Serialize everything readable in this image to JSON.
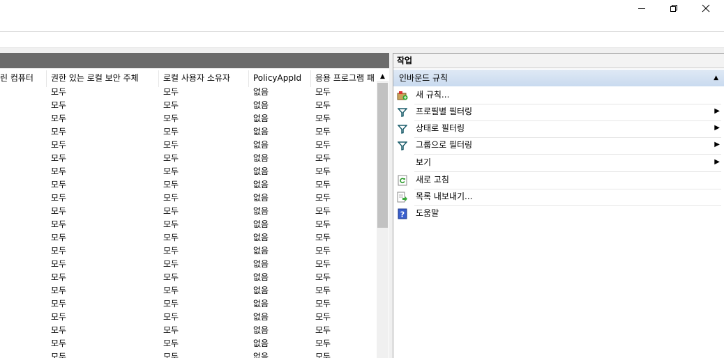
{
  "window": {
    "controls": [
      {
        "name": "minimize",
        "glyph": "—"
      },
      {
        "name": "restore",
        "glyph": "❐"
      },
      {
        "name": "close",
        "glyph": "✕"
      }
    ]
  },
  "table": {
    "columns": [
      "린 컴퓨터",
      "권한 있는 로컬 보안 주체",
      "로컬 사용자 소유자",
      "PolicyAppId",
      "응용 프로그램 패"
    ],
    "row_values": [
      "",
      "모두",
      "모두",
      "없음",
      "모두"
    ],
    "partial_row_values": [
      "",
      "모두",
      "모두",
      "없음",
      "모두"
    ],
    "row_count": 20,
    "scroll_up_glyph": "▲"
  },
  "actions": {
    "title": "작업",
    "section": {
      "title": "인바운드 규칙",
      "collapse_glyph": "▲"
    },
    "items": [
      {
        "id": "new-rule",
        "label": "새 규칙...",
        "icon": "new-rule-icon",
        "submenu": false
      },
      {
        "id": "filter-profile",
        "label": "프로필별 필터링",
        "icon": "filter-icon",
        "submenu": true
      },
      {
        "id": "filter-state",
        "label": "상태로 필터링",
        "icon": "filter-icon",
        "submenu": true
      },
      {
        "id": "filter-group",
        "label": "그룹으로 필터링",
        "icon": "filter-icon",
        "submenu": true
      },
      {
        "id": "view",
        "label": "보기",
        "icon": "",
        "submenu": true
      },
      {
        "id": "refresh",
        "label": "새로 고침",
        "icon": "refresh-icon",
        "submenu": false
      },
      {
        "id": "export-list",
        "label": "목록 내보내기...",
        "icon": "export-icon",
        "submenu": false
      },
      {
        "id": "help",
        "label": "도움말",
        "icon": "help-icon",
        "submenu": false
      }
    ],
    "submenu_glyph": "▶"
  },
  "colors": {
    "header_dark": "#6b6b6b",
    "section_blue": "#c9daef",
    "help_blue": "#3a5fcd"
  }
}
